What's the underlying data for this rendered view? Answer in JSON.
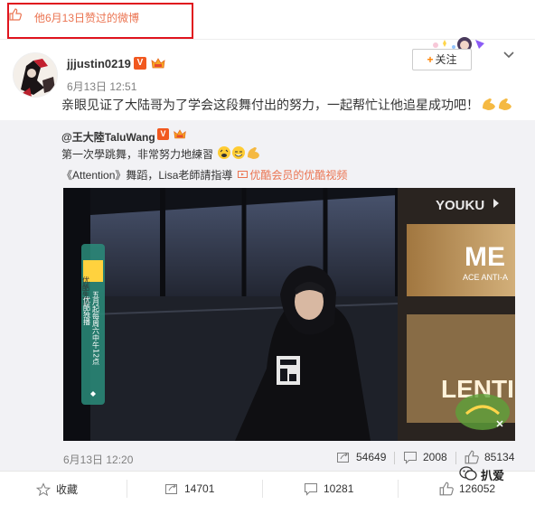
{
  "liked_bar": {
    "text": "他6月13日赞过的微博"
  },
  "post": {
    "username": "jjjustin0219",
    "vip_badge": "V",
    "time": "6月13日 12:51",
    "text": "亲眼见证了大陆哥为了学会这段舞付出的努力，一起帮忙让他追星成功吧！",
    "follow_label": "关注"
  },
  "repost": {
    "author": "@王大陸TaluWang",
    "vip_badge": "V",
    "text": "第一次學跳舞，非常努力地練習",
    "line3_prefix": "《Attention》舞蹈，Lisa老師請指導",
    "video_link": "优酷会员的优酷视频",
    "date": "6月13日 12:20",
    "stats": {
      "forward": "54649",
      "comment": "2008",
      "like": "85134"
    }
  },
  "video": {
    "watermark": "YOUKU",
    "sign_text": "ME",
    "sign_subtext": "ACE ANTI-A",
    "sign2": "LENTI",
    "banner_top": "优酷生活",
    "banner_text": "五月起每周六中午12点",
    "banner_sub": "优酷独播"
  },
  "bottom": {
    "favorite": "收藏",
    "forward": "14701",
    "comment": "10281",
    "like": "126052"
  },
  "watermark_text": "扒爱",
  "colors": {
    "accent": "#eb7350",
    "highlight_box": "#e0141e",
    "orange": "#ff8200"
  }
}
